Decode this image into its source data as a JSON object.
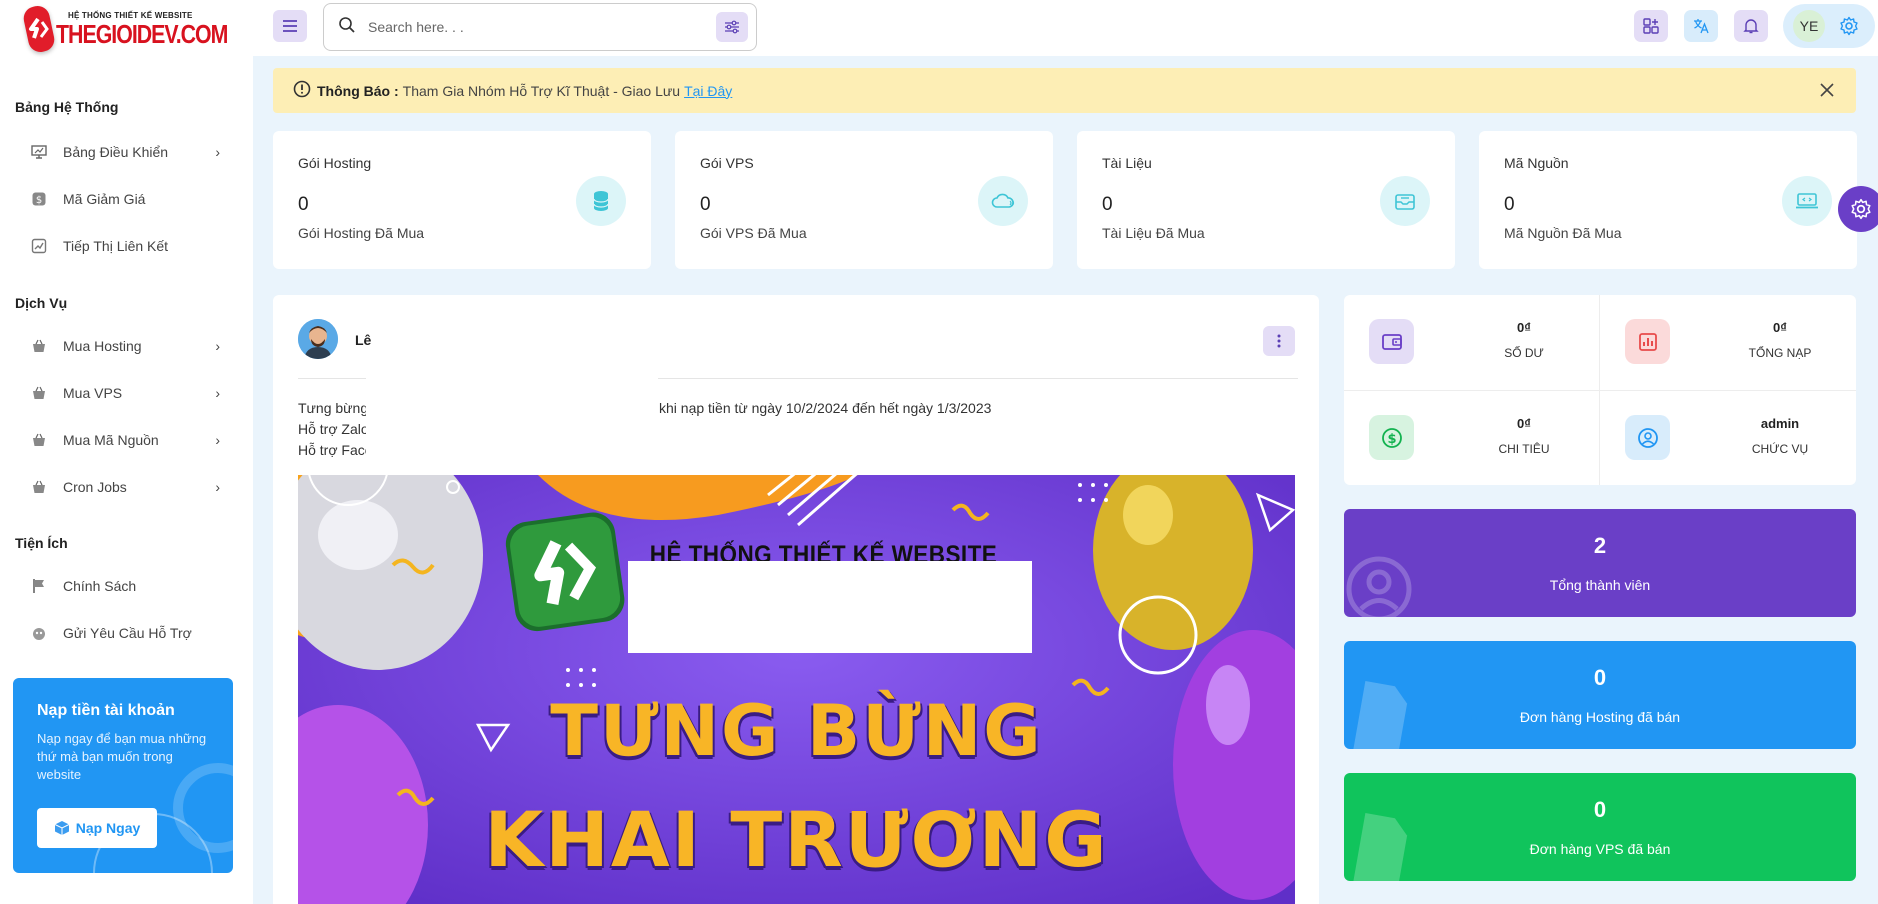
{
  "brand": {
    "small": "HỆ THỐNG THIẾT KẾ WEBSITE",
    "big": "THEGIOIDEV.COM",
    "color": "#d8121f"
  },
  "search": {
    "placeholder": "Search here. . ."
  },
  "topbar": {
    "avatar_initials": "YE"
  },
  "sidebar": {
    "sections": [
      {
        "title": "Bảng Hệ Thống",
        "items": [
          {
            "label": "Bảng Điều Khiển",
            "icon": "dashboard-icon",
            "has_submenu": true
          },
          {
            "label": "Mã Giảm Giá",
            "icon": "coupon-icon",
            "has_submenu": false
          },
          {
            "label": "Tiếp Thị Liên Kết",
            "icon": "affiliate-icon",
            "has_submenu": false
          }
        ]
      },
      {
        "title": "Dịch Vụ",
        "items": [
          {
            "label": "Mua Hosting",
            "icon": "basket-icon",
            "has_submenu": true
          },
          {
            "label": "Mua VPS",
            "icon": "basket-icon",
            "has_submenu": true
          },
          {
            "label": "Mua Mã Nguồn",
            "icon": "basket-icon",
            "has_submenu": true
          },
          {
            "label": "Cron Jobs",
            "icon": "basket-icon",
            "has_submenu": true
          }
        ]
      },
      {
        "title": "Tiện Ích",
        "items": [
          {
            "label": "Chính Sách",
            "icon": "flag-icon",
            "has_submenu": false
          },
          {
            "label": "Gửi Yêu Cầu Hỗ Trợ",
            "icon": "support-icon",
            "has_submenu": false
          }
        ]
      }
    ],
    "promo": {
      "title": "Nạp tiền tài khoản",
      "text": "Nạp ngay để bạn mua những thứ mà bạn muốn trong website",
      "button": "Nạp Ngay",
      "color": "#2196f3"
    }
  },
  "notice": {
    "label": "Thông Báo :",
    "text": "Tham Gia Nhóm Hỗ Trợ Kĩ Thuật - Giao Lưu",
    "link": "Tại Đây",
    "color": "#fdeeb5"
  },
  "stats": [
    {
      "title": "Gói Hosting",
      "value": "0",
      "sub": "Gói Hosting Đã Mua",
      "icon": "database-icon"
    },
    {
      "title": "Gói VPS",
      "value": "0",
      "sub": "Gói VPS Đã Mua",
      "icon": "cloud-icon"
    },
    {
      "title": "Tài Liệu",
      "value": "0",
      "sub": "Tài Liệu Đã Mua",
      "icon": "inbox-icon"
    },
    {
      "title": "Mã Nguồn",
      "value": "0",
      "sub": "Mã Nguồn Đã Mua",
      "icon": "laptop-code-icon"
    }
  ],
  "post": {
    "author": "Lê",
    "lines": [
      "Tưng bừng",
      "Hỗ trợ Zalo",
      "Hỗ trợ Face"
    ],
    "line1_tail": "khi nạp tiền từ ngày 10/2/2024 đến hết ngày 1/3/2023",
    "banner": {
      "header": "HỆ THỐNG THIẾT KẾ WEBSITE",
      "line1": "TƯNG BỪNG",
      "line2": "KHAI TRƯƠNG",
      "bg_color": "#7c4ee0"
    }
  },
  "account": [
    {
      "value": "0₫",
      "label": "SỐ DƯ",
      "icon": "wallet-icon",
      "color": "#e4ddf6"
    },
    {
      "value": "0₫",
      "label": "TỔNG NẠP",
      "icon": "chart-icon",
      "color": "#fbdada"
    },
    {
      "value": "0₫",
      "label": "CHI TIÊU",
      "icon": "dollar-icon",
      "color": "#d7f3e0"
    },
    {
      "value": "admin",
      "label": "CHỨC VỤ",
      "icon": "user-circle-icon",
      "color": "#d8ecfb"
    }
  ],
  "summary": [
    {
      "value": "2",
      "label": "Tổng thành viên",
      "color": "#6a3fc7",
      "icon": "user-icon"
    },
    {
      "value": "0",
      "label": "Đơn hàng Hosting đã bán",
      "color": "#2196f3",
      "icon": "document-icon"
    },
    {
      "value": "0",
      "label": "Đơn hàng VPS đã bán",
      "color": "#10c45c",
      "icon": "document-icon"
    }
  ]
}
